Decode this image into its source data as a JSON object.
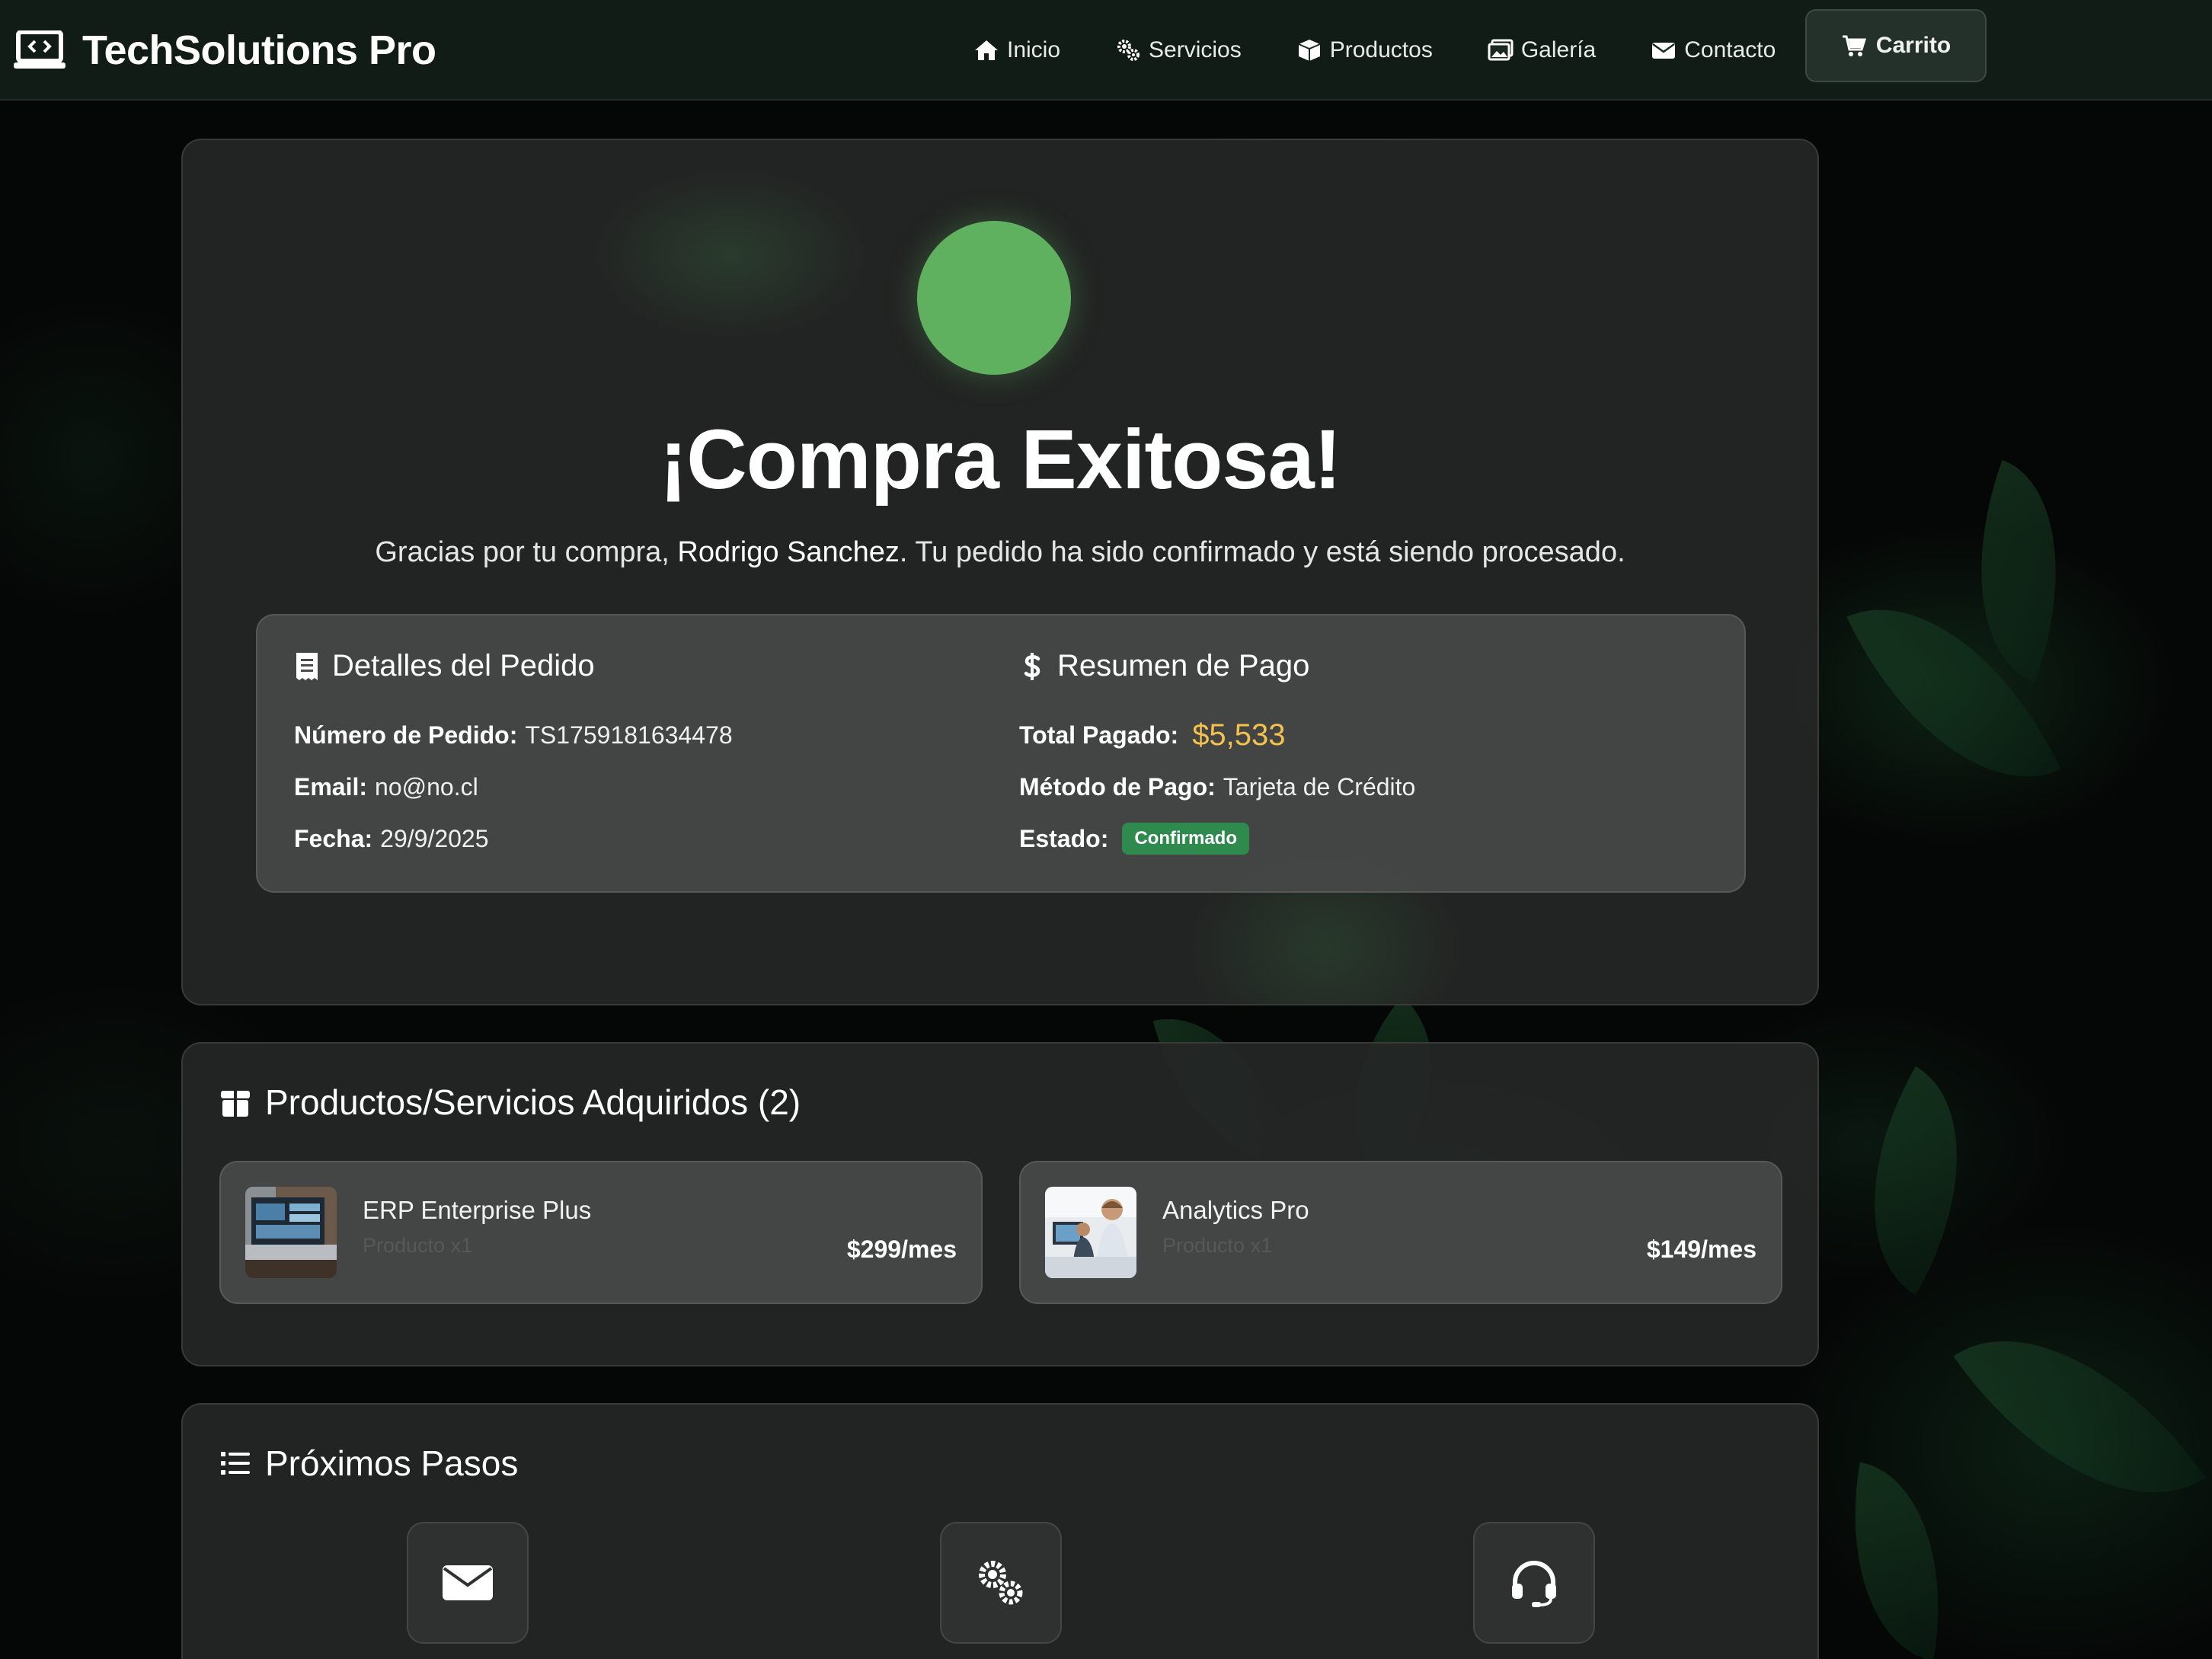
{
  "navbar": {
    "brand": "TechSolutions Pro",
    "links": [
      {
        "label": "Inicio",
        "icon": "home-icon"
      },
      {
        "label": "Servicios",
        "icon": "gears-icon"
      },
      {
        "label": "Productos",
        "icon": "box-icon"
      },
      {
        "label": "Galería",
        "icon": "images-icon"
      },
      {
        "label": "Contacto",
        "icon": "envelope-icon"
      }
    ],
    "cart_label": "Carrito"
  },
  "success": {
    "title": "¡Compra Exitosa!",
    "subtitle_before": "Gracias por tu compra, ",
    "customer_name": "Rodrigo Sanchez",
    "subtitle_after": ". Tu pedido ha sido confirmado y está siendo procesado."
  },
  "order_details": {
    "heading": "Detalles del Pedido",
    "order_number_label": "Número de Pedido:",
    "order_number": "TS1759181634478",
    "email_label": "Email:",
    "email": "no@no.cl",
    "date_label": "Fecha:",
    "date": "29/9/2025"
  },
  "payment_summary": {
    "heading": "Resumen de Pago",
    "total_label": "Total Pagado:",
    "total": "$5,533",
    "method_label": "Método de Pago:",
    "method": "Tarjeta de Crédito",
    "status_label": "Estado:",
    "status": "Confirmado"
  },
  "products": {
    "heading": "Productos/Servicios Adquiridos (2)",
    "items": [
      {
        "name": "ERP Enterprise Plus",
        "type": "Producto x1",
        "price": "$299/mes"
      },
      {
        "name": "Analytics Pro",
        "type": "Producto x1",
        "price": "$149/mes"
      }
    ]
  },
  "next_steps": {
    "heading": "Próximos Pasos",
    "icons": [
      "envelope-icon",
      "gears-icon",
      "headset-icon"
    ]
  },
  "colors": {
    "accent_green": "#5fb15f",
    "total_gold": "#f2c14e",
    "badge_green": "#2f8a4e"
  }
}
